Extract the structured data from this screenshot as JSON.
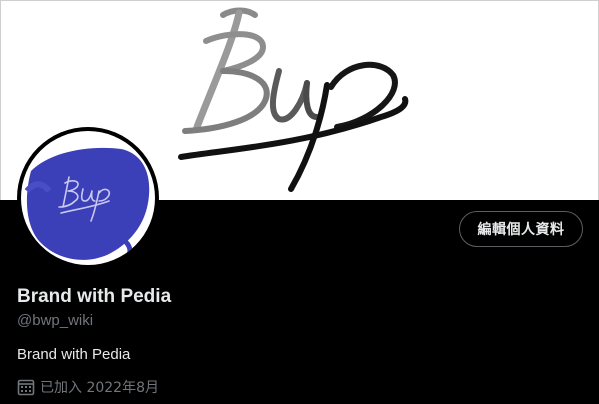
{
  "profile": {
    "display_name": "Brand with Pedia",
    "handle": "@bwp_wiki",
    "bio": "Brand with Pedia",
    "joined": "已加入 2022年8月",
    "edit_profile_label": "編輯個人資料"
  },
  "colors": {
    "background": "#000000",
    "banner": "#ffffff",
    "avatar_blue": "#3b3fb8",
    "text_primary": "#e7e9ea",
    "text_secondary": "#71767b",
    "button_border": "#5b5f63"
  },
  "icons": {
    "joined": "calendar-icon"
  }
}
